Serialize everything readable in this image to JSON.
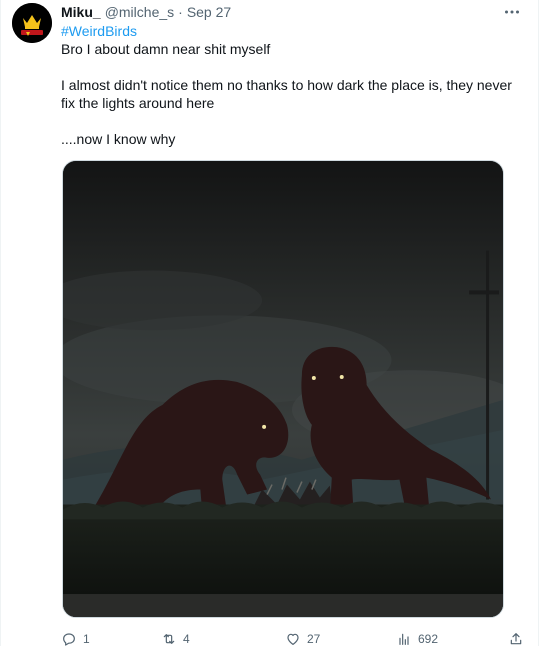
{
  "tweet": {
    "author_name": "Miku_",
    "author_handle": "@milche_s",
    "separator": "·",
    "date": "Sep 27",
    "hashtag": "#WeirdBirds",
    "lines": [
      "Bro I about damn near shit myself",
      "I almost didn't notice them no thanks to how dark the place is, they never fix the lights around here",
      "....now I know why"
    ],
    "more_icon": "ellipsis-icon"
  },
  "actions": {
    "reply_count": "1",
    "retweet_count": "4",
    "like_count": "27",
    "views_count": "692"
  },
  "colors": {
    "link": "#1d9bf0",
    "muted": "#536471",
    "text": "#0f1419"
  }
}
